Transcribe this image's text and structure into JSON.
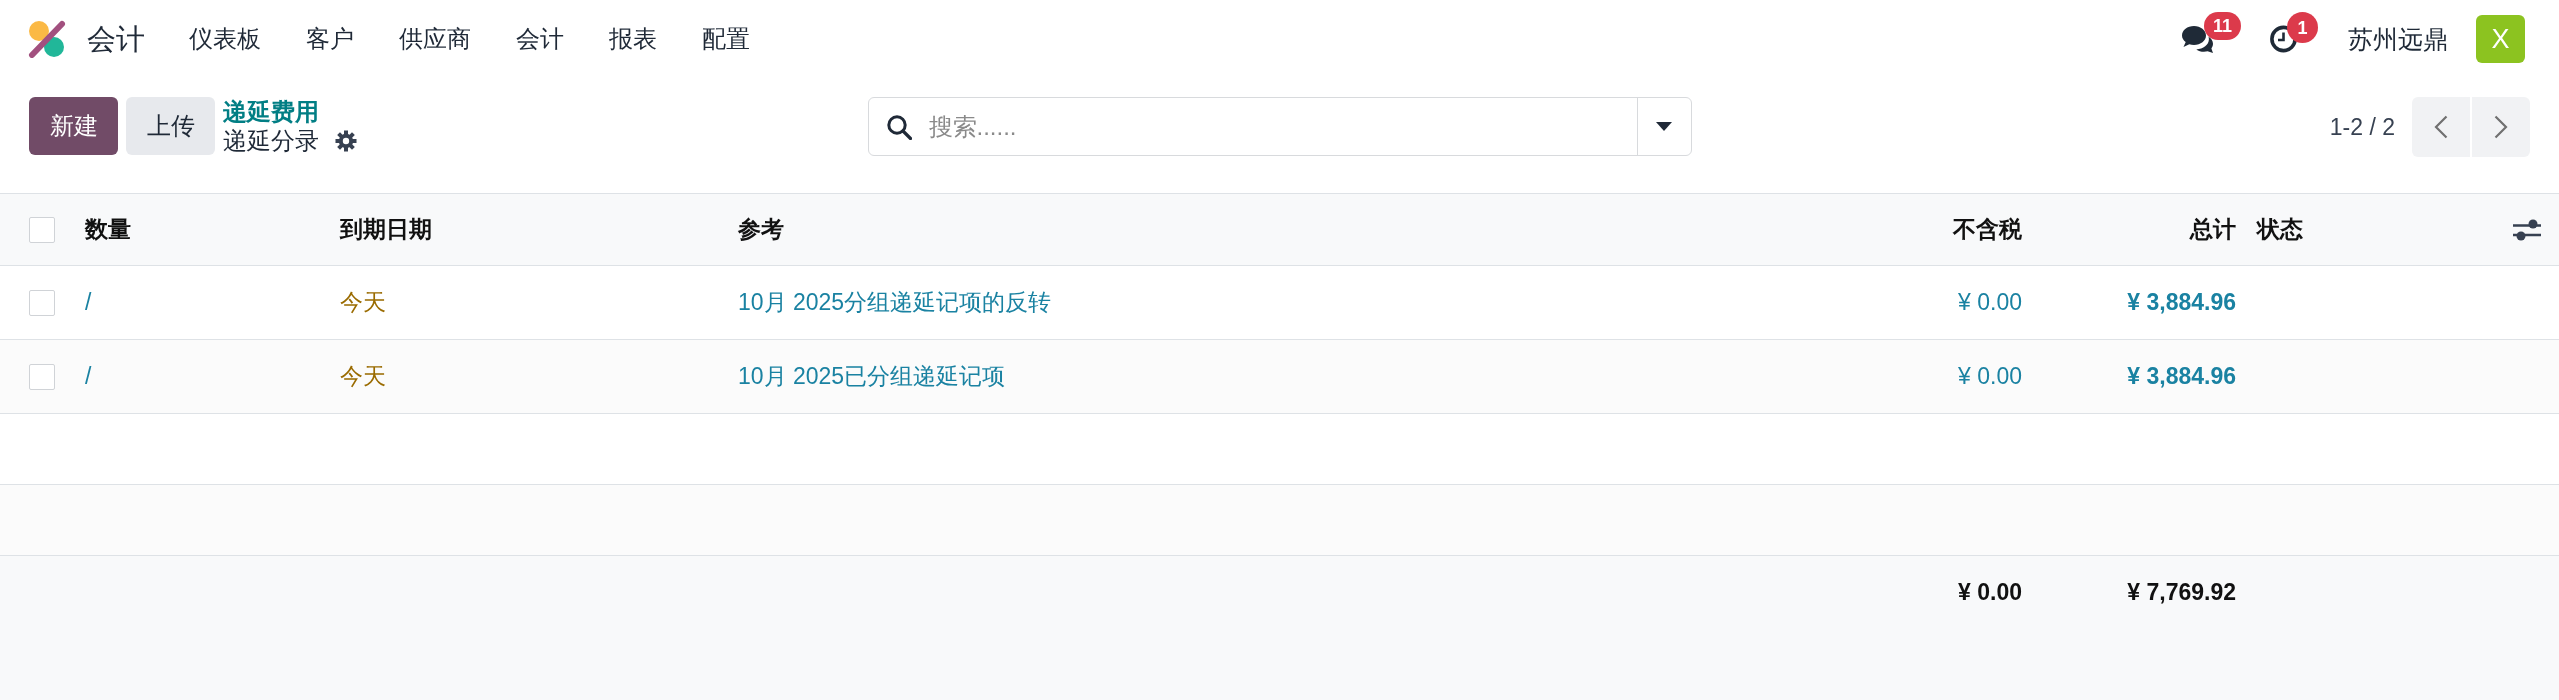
{
  "navbar": {
    "app_name": "会计",
    "menu": [
      {
        "label": "仪表板"
      },
      {
        "label": "客户"
      },
      {
        "label": "供应商"
      },
      {
        "label": "会计"
      },
      {
        "label": "报表"
      },
      {
        "label": "配置"
      }
    ],
    "systray": {
      "messages_count": "11",
      "activities_count": "1",
      "company": "苏州远鼎",
      "avatar_letter": "X"
    }
  },
  "control_panel": {
    "buttons": [
      {
        "label": "新建",
        "kind": "primary"
      },
      {
        "label": "上传",
        "kind": "secondary"
      }
    ],
    "breadcrumb": {
      "parent": "递延费用",
      "current": "递延分录"
    },
    "search": {
      "placeholder": "搜索......"
    },
    "pager": {
      "range": "1-2 / 2"
    }
  },
  "table": {
    "select_all": {
      "checked": false
    },
    "columns": [
      {
        "label": "数量",
        "kind": "text"
      },
      {
        "label": "到期日期",
        "kind": "text"
      },
      {
        "label": "参考",
        "kind": "text"
      },
      {
        "label": "不含税",
        "kind": "money"
      },
      {
        "label": "总计",
        "kind": "money"
      },
      {
        "label": "状态",
        "kind": "text"
      }
    ],
    "rows": [
      {
        "selected": false,
        "number": "/",
        "due_date": {
          "text": "今天",
          "warning": true
        },
        "reference": "10月 2025分组递延记项的反转",
        "untaxed": "¥ 0.00",
        "total": "¥ 3,884.96"
      },
      {
        "selected": false,
        "number": "/",
        "due_date": {
          "text": "今天",
          "warning": true
        },
        "reference": "10月 2025已分组递延记项",
        "untaxed": "¥ 0.00",
        "total": "¥ 3,884.96"
      }
    ],
    "totals": {
      "untaxed": "¥ 0.00",
      "total": "¥ 7,769.92"
    }
  }
}
